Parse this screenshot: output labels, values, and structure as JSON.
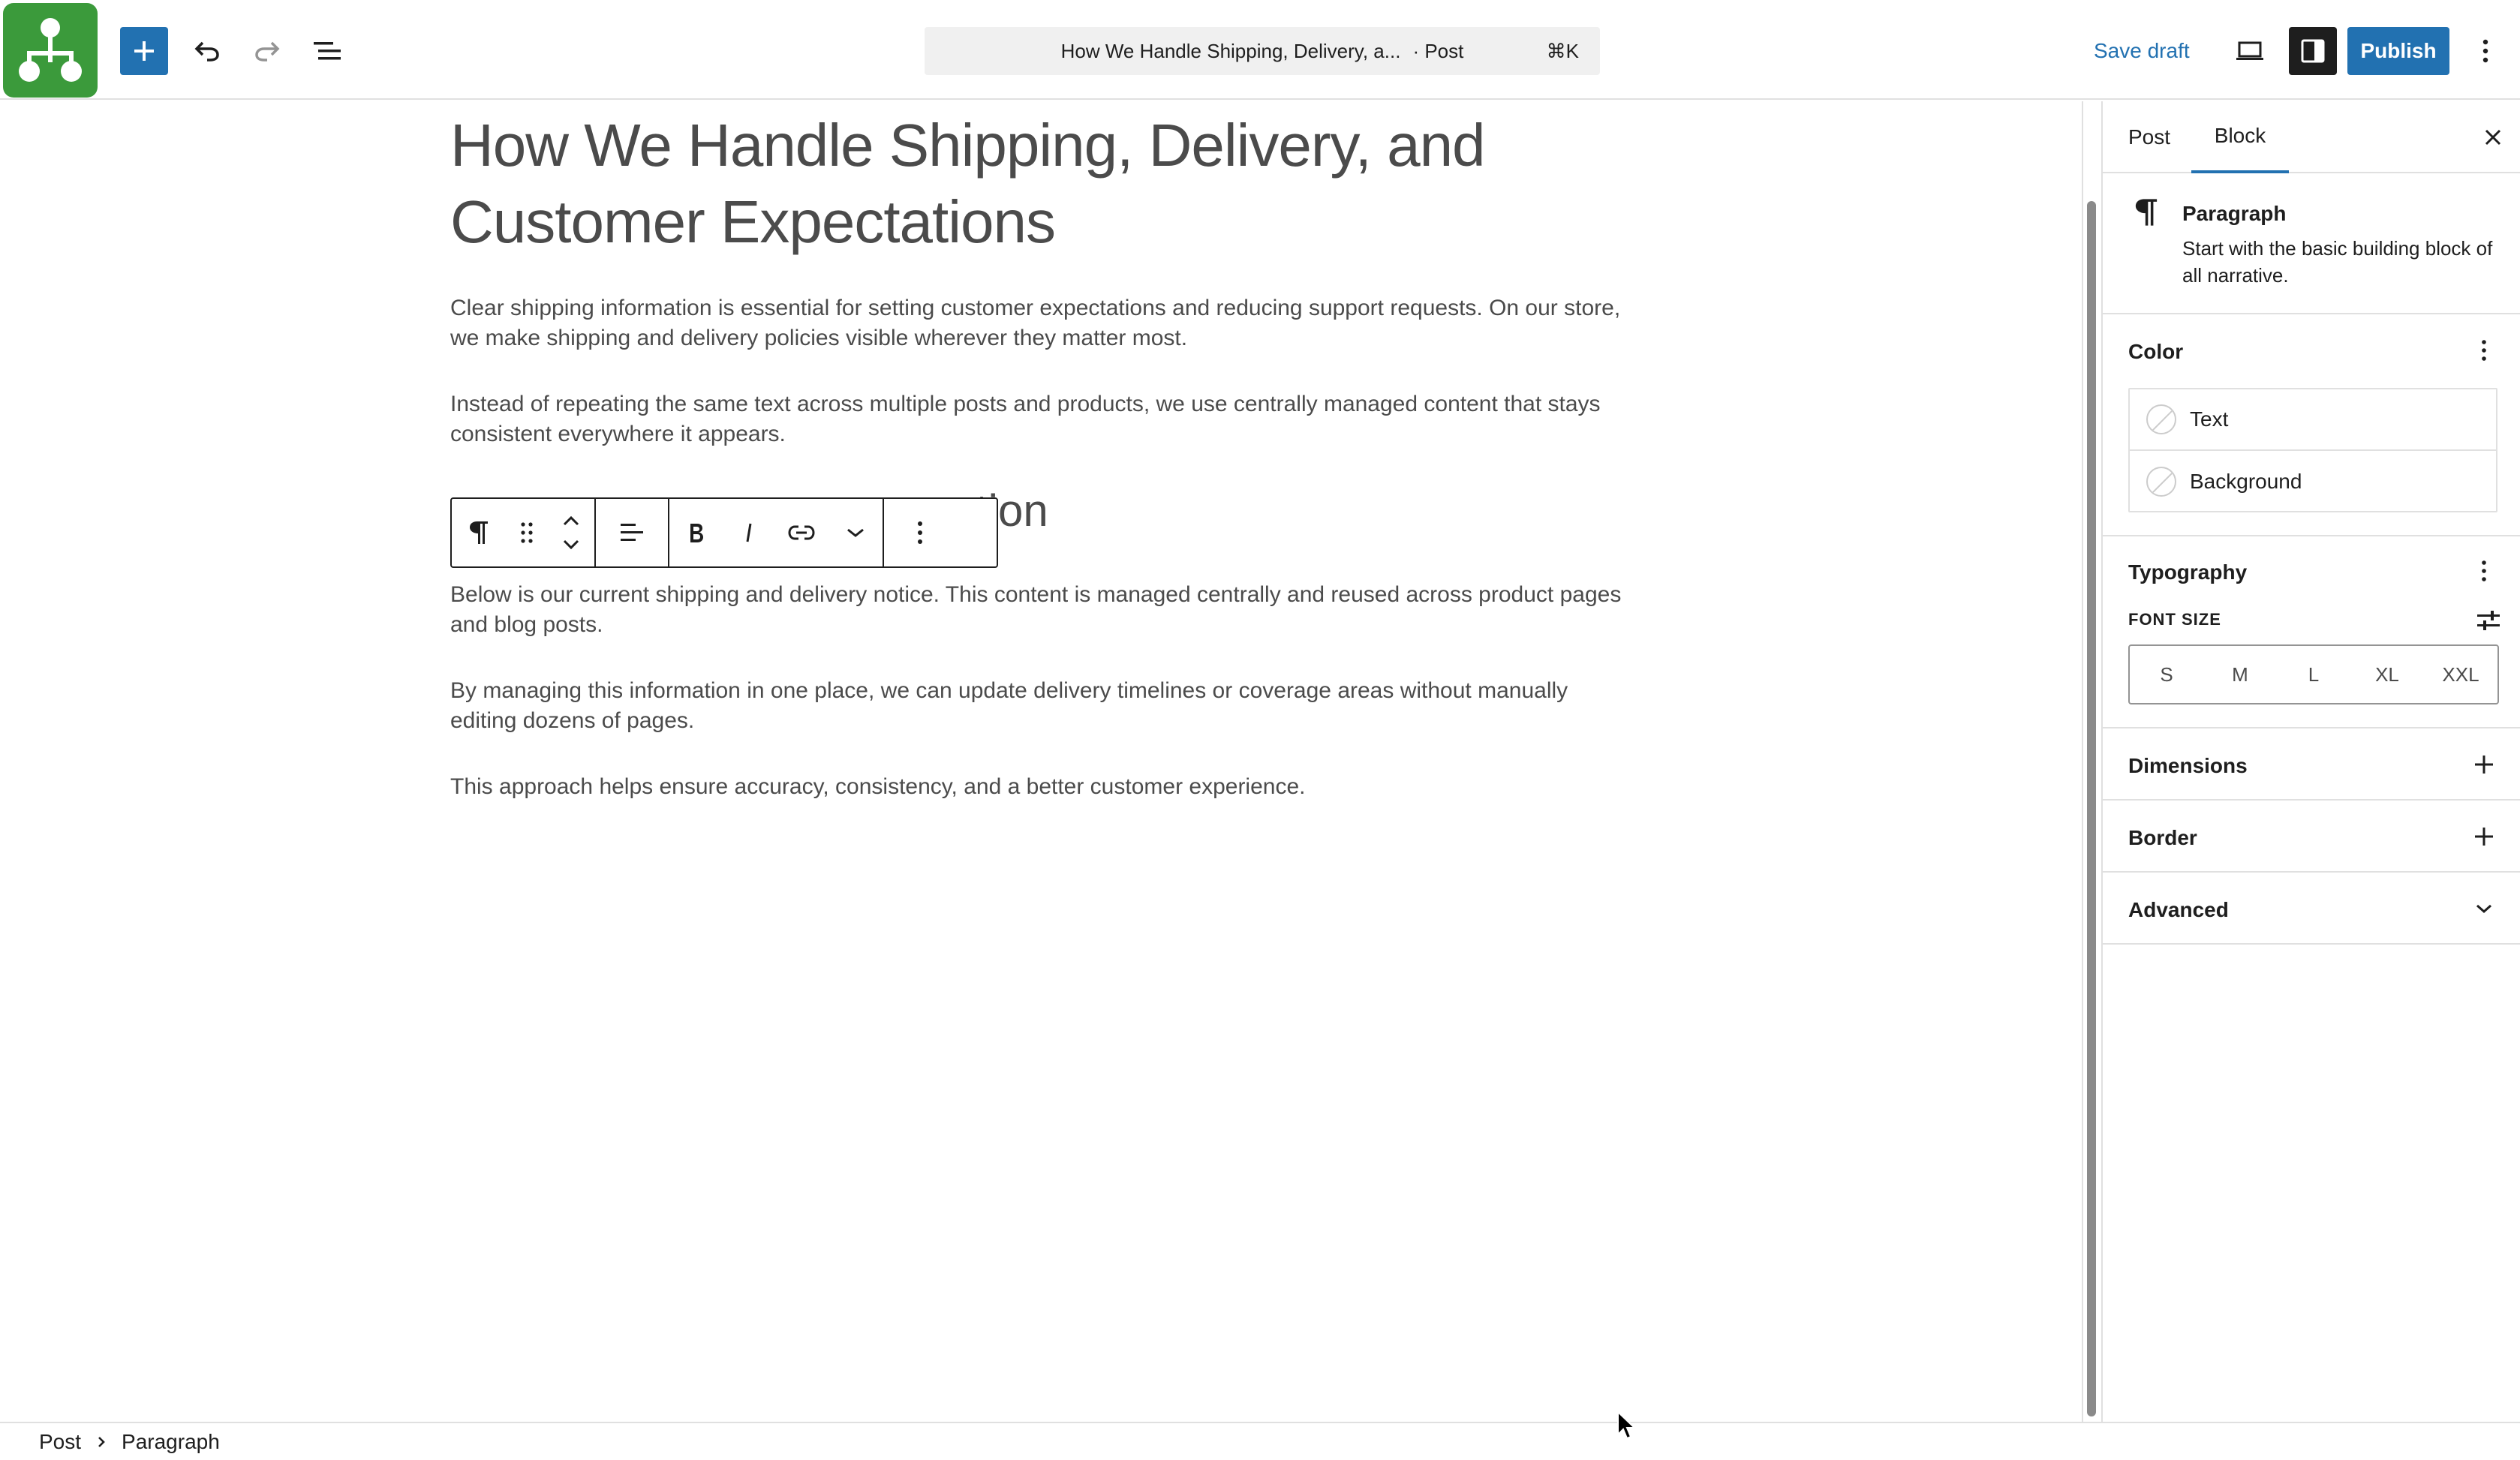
{
  "header": {
    "command_title": "How We Handle Shipping, Delivery, a...",
    "command_type": "· Post",
    "command_shortcut": "⌘K",
    "save_draft_label": "Save draft",
    "publish_label": "Publish"
  },
  "editor": {
    "title": "How We Handle Shipping, Delivery, and Customer Expectations",
    "paragraphs": [
      "Clear shipping information is essential for setting customer expectations and reducing support requests. On our store, we make shipping and delivery policies visible wherever they matter most.",
      "Instead of repeating the same text across multiple posts and products, we use centrally managed content that stays consistent everywhere it appears.",
      "Below is our current shipping and delivery notice. This content is managed centrally and reused across product pages and blog posts.",
      "By managing this information in one place, we can update delivery timelines or coverage areas without manually editing dozens of pages.",
      "This approach helps ensure accuracy, consistency, and a better customer experience."
    ],
    "heading_visible_tail": "tion"
  },
  "sidebar": {
    "tabs": [
      "Post",
      "Block"
    ],
    "active_tab": "Block",
    "block": {
      "name": "Paragraph",
      "description": "Start with the basic building block of all narrative."
    },
    "color": {
      "title": "Color",
      "items": [
        "Text",
        "Background"
      ]
    },
    "typography": {
      "title": "Typography",
      "font_size_label": "FONT SIZE",
      "sizes": [
        "S",
        "M",
        "L",
        "XL",
        "XXL"
      ]
    },
    "panels": {
      "dimensions": "Dimensions",
      "border": "Border",
      "advanced": "Advanced"
    }
  },
  "footer": {
    "breadcrumbs": [
      "Post",
      "Paragraph"
    ]
  },
  "colors": {
    "accent": "#2271b1",
    "logo": "#3b9a3b",
    "text": "#1e1e1e",
    "body_text": "#4b4b4b"
  }
}
